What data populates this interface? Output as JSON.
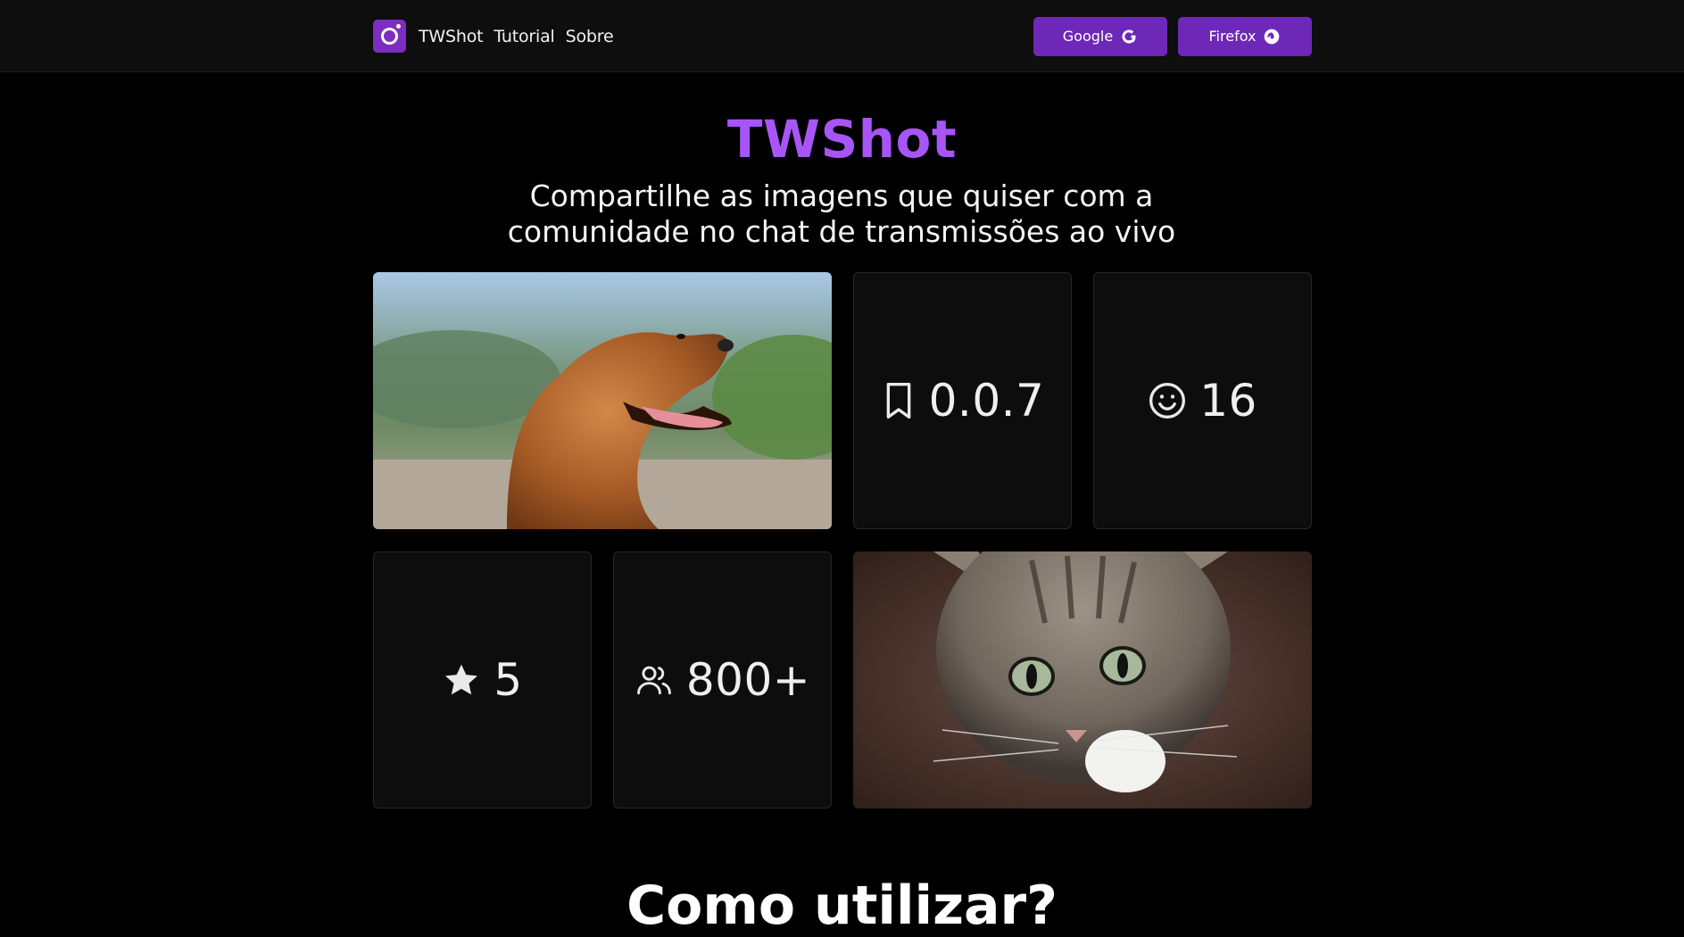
{
  "header": {
    "brand": "TWShot",
    "links": [
      "Tutorial",
      "Sobre"
    ],
    "buttons": {
      "google": "Google",
      "firefox": "Firefox"
    }
  },
  "hero": {
    "title": "TWShot",
    "subtitle": "Compartilhe as imagens que quiser com a comunidade no chat de transmissões ao vivo"
  },
  "stats": {
    "version": "0.0.7",
    "emojis": "16",
    "rating": "5",
    "users": "800+"
  },
  "icons": {
    "logo": "camera-ring-icon",
    "google": "google-g-icon",
    "firefox": "firefox-icon",
    "version": "bookmark-icon",
    "emojis": "smile-icon",
    "rating": "star-icon",
    "users": "users-icon"
  },
  "section": {
    "title": "Como utilizar?"
  },
  "colors": {
    "accent": "#a855f7",
    "button": "#6d28b8",
    "background": "#000000",
    "card": "#0d0d0d"
  }
}
